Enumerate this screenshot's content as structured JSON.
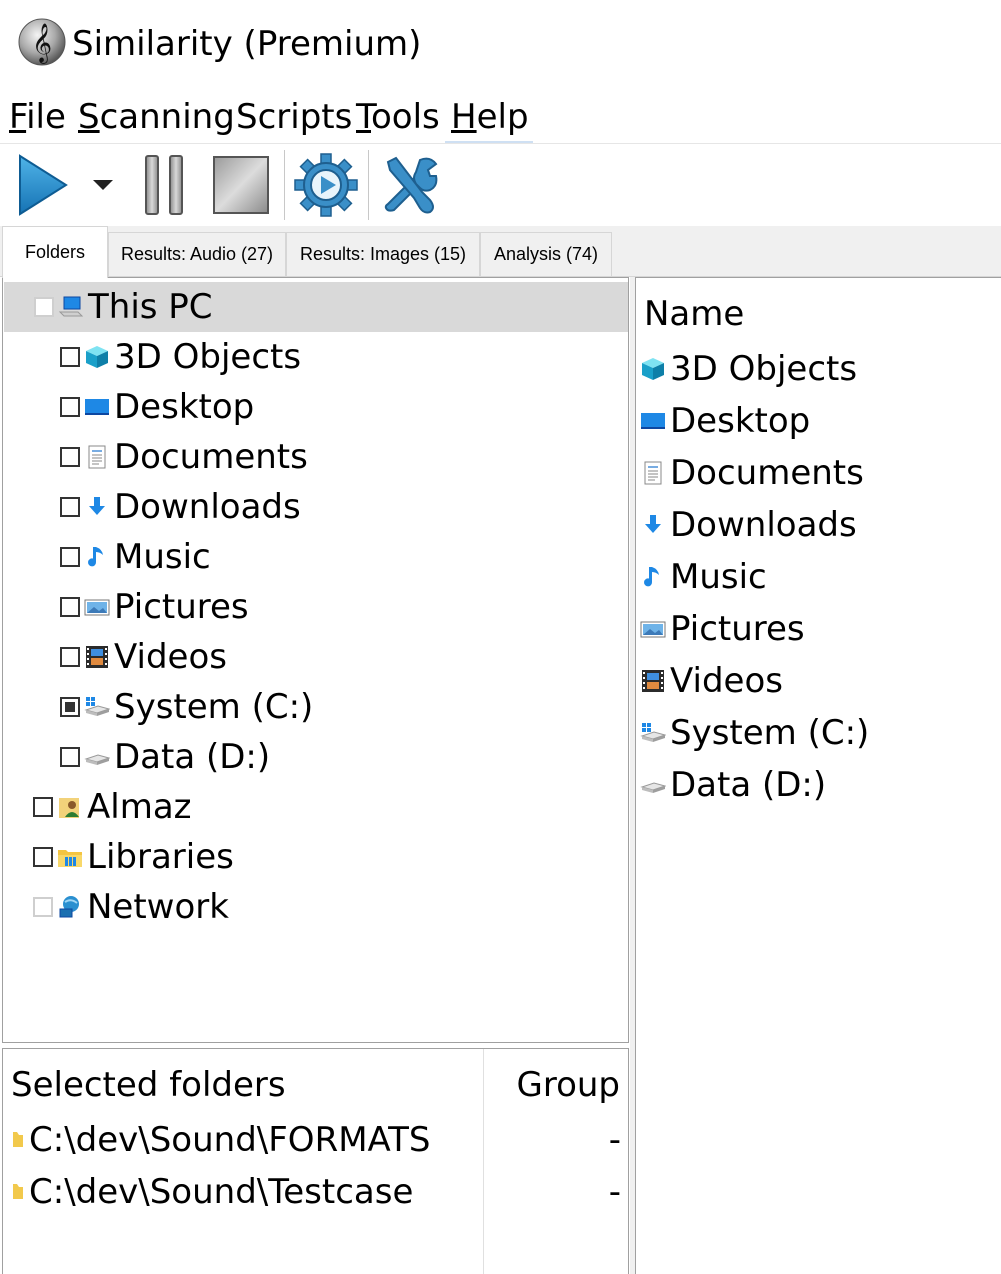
{
  "window": {
    "title": "Similarity (Premium)",
    "app_icon": "treble-clef-icon"
  },
  "menu": {
    "items": [
      {
        "label": "File",
        "accel": "F",
        "rest": "ile"
      },
      {
        "label": "Scanning",
        "accel": "S",
        "rest": "canning"
      },
      {
        "label": "Scripts",
        "accel": "",
        "rest": "Scripts"
      },
      {
        "label": "Tools",
        "accel": "T",
        "rest": "ools"
      },
      {
        "label": "Help",
        "accel": "H",
        "rest": "elp"
      }
    ]
  },
  "toolbar": {
    "buttons": [
      {
        "name": "play-button",
        "icon": "play-icon"
      },
      {
        "name": "play-dropdown-button",
        "icon": "chevron-down-icon"
      },
      {
        "name": "pause-button",
        "icon": "pause-icon"
      },
      {
        "name": "stop-button",
        "icon": "stop-icon"
      },
      {
        "name": "settings-run-button",
        "icon": "gear-play-icon"
      },
      {
        "name": "tools-button",
        "icon": "wrench-screwdriver-icon"
      }
    ]
  },
  "tabs": [
    {
      "label": "Folders",
      "active": true
    },
    {
      "label": "Results: Audio (27)",
      "active": false
    },
    {
      "label": "Results: Images (15)",
      "active": false
    },
    {
      "label": "Analysis (74)",
      "active": false
    }
  ],
  "tree": {
    "root": {
      "label": "This PC",
      "icon": "computer-icon",
      "checked": "none"
    },
    "children": [
      {
        "label": "3D Objects",
        "icon": "cube-icon",
        "checked": "none"
      },
      {
        "label": "Desktop",
        "icon": "desktop-icon",
        "checked": "none"
      },
      {
        "label": "Documents",
        "icon": "document-icon",
        "checked": "none"
      },
      {
        "label": "Downloads",
        "icon": "download-arrow-icon",
        "checked": "none"
      },
      {
        "label": "Music",
        "icon": "music-note-icon",
        "checked": "none"
      },
      {
        "label": "Pictures",
        "icon": "picture-icon",
        "checked": "none"
      },
      {
        "label": "Videos",
        "icon": "film-icon",
        "checked": "none"
      },
      {
        "label": "System (C:)",
        "icon": "system-drive-icon",
        "checked": "partial"
      },
      {
        "label": "Data (D:)",
        "icon": "drive-icon",
        "checked": "none"
      }
    ],
    "siblings": [
      {
        "label": "Almaz",
        "icon": "user-folder-icon",
        "checked": "none"
      },
      {
        "label": "Libraries",
        "icon": "libraries-icon",
        "checked": "none"
      },
      {
        "label": "Network",
        "icon": "network-icon",
        "checked": "none"
      }
    ]
  },
  "file_list": {
    "header": "Name",
    "items": [
      {
        "label": "3D Objects",
        "icon": "cube-icon"
      },
      {
        "label": "Desktop",
        "icon": "desktop-icon"
      },
      {
        "label": "Documents",
        "icon": "document-icon"
      },
      {
        "label": "Downloads",
        "icon": "download-arrow-icon"
      },
      {
        "label": "Music",
        "icon": "music-note-icon"
      },
      {
        "label": "Pictures",
        "icon": "picture-icon"
      },
      {
        "label": "Videos",
        "icon": "film-icon"
      },
      {
        "label": "System (C:)",
        "icon": "system-drive-icon"
      },
      {
        "label": "Data (D:)",
        "icon": "drive-icon"
      }
    ]
  },
  "selected_folders": {
    "header_path": "Selected folders",
    "header_group": "Group",
    "rows": [
      {
        "path": "C:\\dev\\Sound\\FORMATS",
        "group": "-",
        "icon": "folder-icon"
      },
      {
        "path": "C:\\dev\\Sound\\Testcase",
        "group": "-",
        "icon": "folder-icon"
      }
    ]
  },
  "colors": {
    "accent_blue": "#2a8fd0",
    "selected_row": "#d9d9d9",
    "tab_bg": "#f0f0f0"
  }
}
